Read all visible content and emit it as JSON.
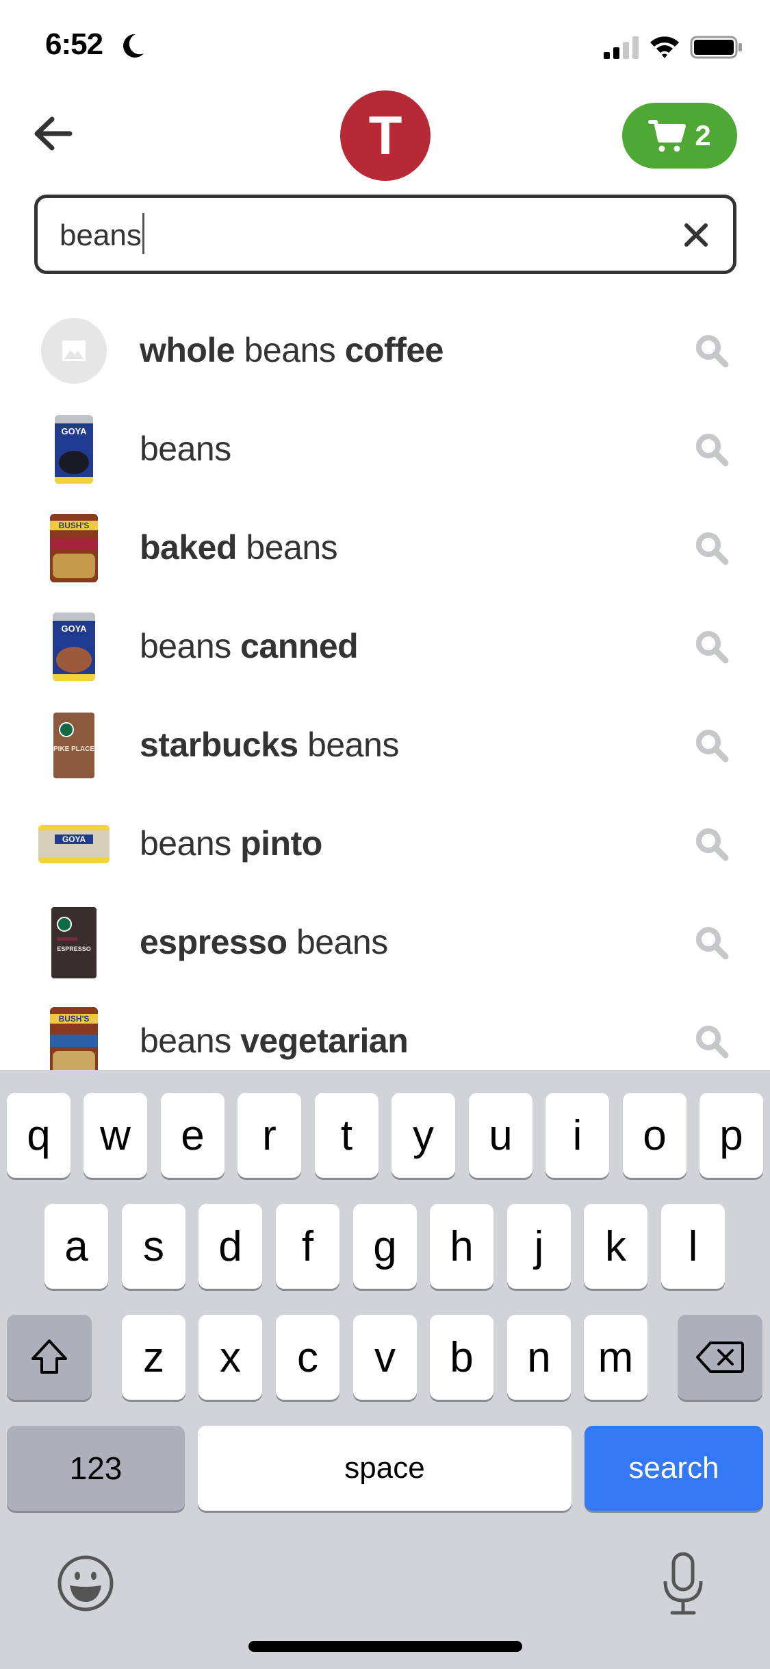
{
  "status_bar": {
    "time": "6:52",
    "focus_icon": "moon-icon",
    "signal_icon": "cellular-signal-icon",
    "wifi_icon": "wifi-icon",
    "battery_icon": "battery-icon"
  },
  "header": {
    "back_icon": "arrow-left-icon",
    "store_initial": "T",
    "store_color": "#b72a35",
    "cart_icon": "cart-icon",
    "cart_count": "2",
    "cart_color": "#4fa834"
  },
  "search": {
    "value": "beans",
    "clear_icon": "close-icon"
  },
  "suggestions": [
    {
      "parts": [
        {
          "text": "whole",
          "bold": true
        },
        {
          "text": " beans ",
          "bold": false
        },
        {
          "text": "coffee",
          "bold": true
        }
      ],
      "thumb": "placeholder-image"
    },
    {
      "parts": [
        {
          "text": "beans",
          "bold": false
        }
      ],
      "thumb": "goya-black-beans-can"
    },
    {
      "parts": [
        {
          "text": "baked",
          "bold": true
        },
        {
          "text": " beans",
          "bold": false
        }
      ],
      "thumb": "bushs-baked-beans-can"
    },
    {
      "parts": [
        {
          "text": "beans ",
          "bold": false
        },
        {
          "text": "canned",
          "bold": true
        }
      ],
      "thumb": "goya-pinto-beans-can"
    },
    {
      "parts": [
        {
          "text": "starbucks",
          "bold": true
        },
        {
          "text": " beans",
          "bold": false
        }
      ],
      "thumb": "starbucks-pike-place-bag"
    },
    {
      "parts": [
        {
          "text": "beans ",
          "bold": false
        },
        {
          "text": "pinto",
          "bold": true
        }
      ],
      "thumb": "goya-pinto-beans-bag"
    },
    {
      "parts": [
        {
          "text": "espresso",
          "bold": true
        },
        {
          "text": " beans",
          "bold": false
        }
      ],
      "thumb": "starbucks-espresso-bag"
    },
    {
      "parts": [
        {
          "text": "beans ",
          "bold": false
        },
        {
          "text": "vegetarian",
          "bold": true
        }
      ],
      "thumb": "bushs-vegetarian-beans-can"
    }
  ],
  "thumb_labels": {
    "goya": "GOYA",
    "bushs": "BUSH'S",
    "pike": "PIKE PLACE",
    "espresso": "ESPRESSO"
  },
  "keyboard": {
    "row1": [
      "q",
      "w",
      "e",
      "r",
      "t",
      "y",
      "u",
      "i",
      "o",
      "p"
    ],
    "row2": [
      "a",
      "s",
      "d",
      "f",
      "g",
      "h",
      "j",
      "k",
      "l"
    ],
    "row3": [
      "z",
      "x",
      "c",
      "v",
      "b",
      "n",
      "m"
    ],
    "shift_icon": "shift-icon",
    "delete_icon": "backspace-icon",
    "numbers_label": "123",
    "space_label": "space",
    "action_label": "search",
    "emoji_icon": "emoji-icon",
    "mic_icon": "microphone-icon"
  }
}
